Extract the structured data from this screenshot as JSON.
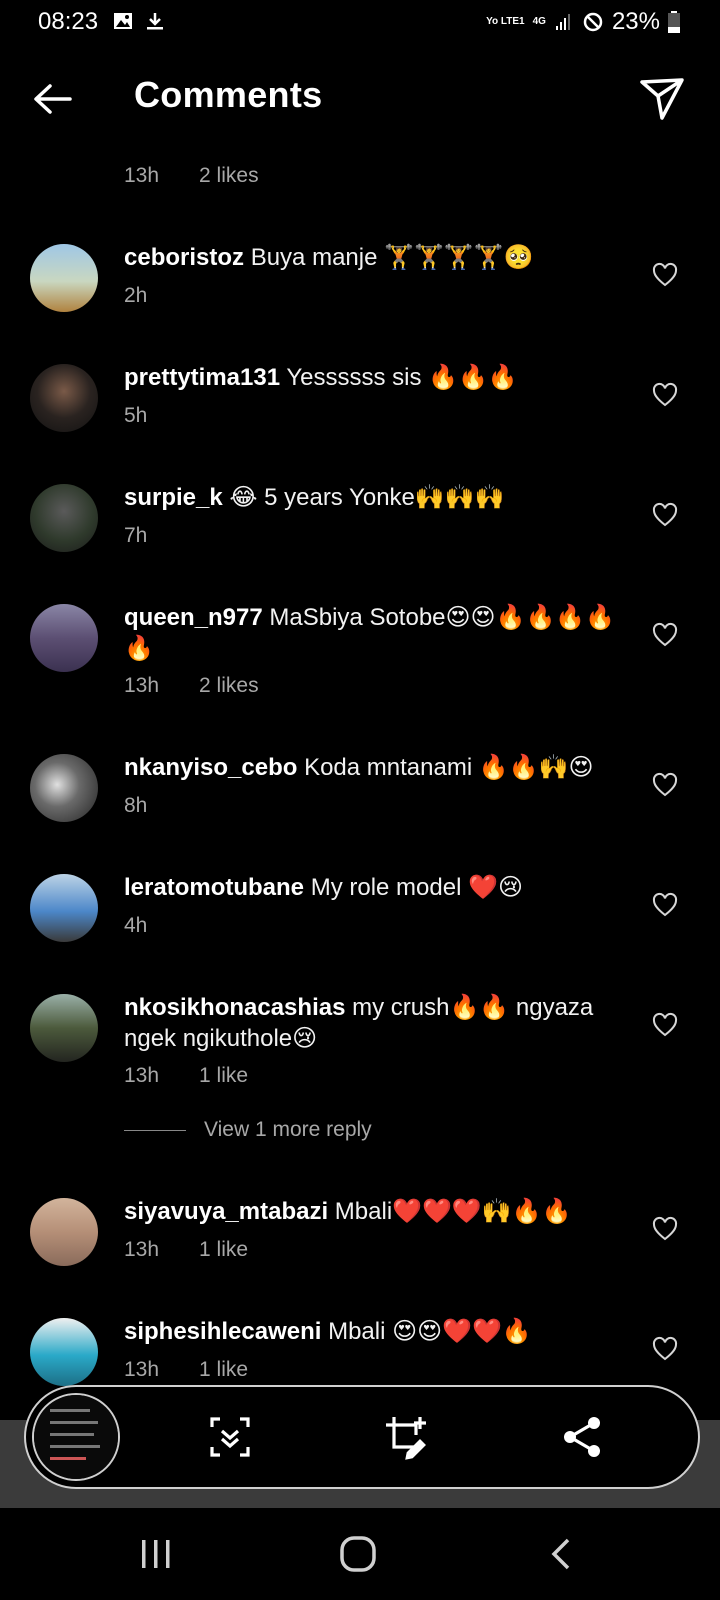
{
  "status_bar": {
    "time": "08:23",
    "network": "Yo LTE1",
    "signal": "4G",
    "battery": "23%"
  },
  "header": {
    "title": "Comments"
  },
  "partial_comment": {
    "time": "13h",
    "likes": "2 likes"
  },
  "comments": [
    {
      "user": "ceboristoz",
      "text": "Buya manje 🏋🏋🏋🏋🥺",
      "time": "2h",
      "likes": ""
    },
    {
      "user": "prettytima131",
      "text": "Yessssss sis 🔥🔥🔥",
      "time": "5h",
      "likes": ""
    },
    {
      "user": "surpie_k",
      "text": "😂 5 years Yonke🙌🙌🙌",
      "time": "7h",
      "likes": ""
    },
    {
      "user": "queen_n977",
      "text": "MaSbiya Sotobe😍😍🔥🔥🔥🔥🔥",
      "time": "13h",
      "likes": "2 likes"
    },
    {
      "user": "nkanyiso_cebo",
      "text": "Koda mntanami 🔥🔥🙌😍",
      "time": "8h",
      "likes": ""
    },
    {
      "user": "leratomotubane",
      "text": "My role model ❤️😢",
      "time": "4h",
      "likes": ""
    },
    {
      "user": "nkosikhonacashias",
      "text": "my crush🔥🔥 ngyaza ngek ngikuthole😢",
      "time": "13h",
      "likes": "1 like"
    },
    {
      "user": "siyavuya_mtabazi",
      "text": "Mbali❤️❤️❤️🙌🔥🔥",
      "time": "13h",
      "likes": "1 like"
    },
    {
      "user": "siphesihlecaweni",
      "text": "Mbali 😍😍❤️❤️🔥",
      "time": "13h",
      "likes": "1 like"
    }
  ],
  "view_more_reply": "View 1 more reply",
  "colors": {
    "background": "#000000",
    "meta_text": "#a8a8a8",
    "toolbar_border": "#d0d0d0"
  },
  "icons": {
    "back": "arrow-left-icon",
    "send": "paper-plane-icon",
    "heart": "heart-outline-icon",
    "scroll_capture": "scroll-capture-icon",
    "crop_edit": "crop-edit-icon",
    "share": "share-icon"
  }
}
